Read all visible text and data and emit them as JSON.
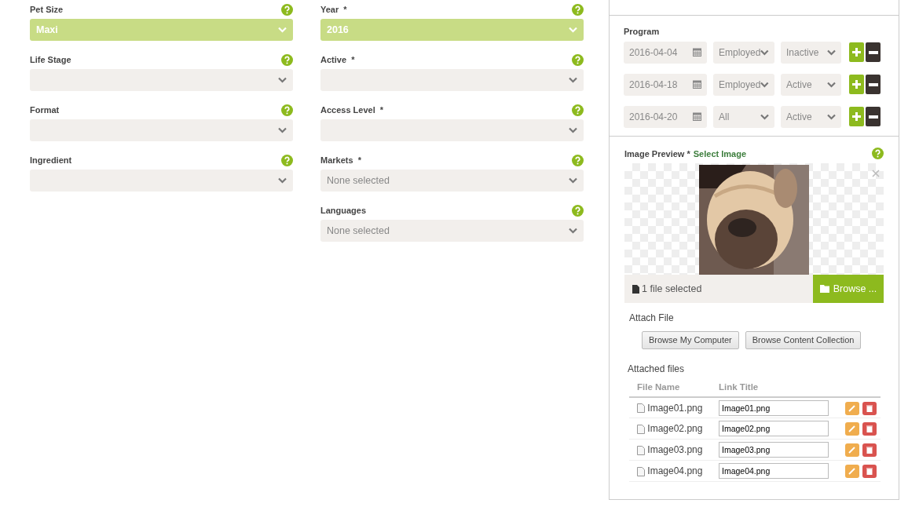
{
  "form": {
    "columns": [
      [
        {
          "label": "Pet Size",
          "highlighted": true,
          "value": "Maxi"
        },
        {
          "label": "Life Stage",
          "highlighted": false
        },
        {
          "label": "Format",
          "highlighted": false
        },
        {
          "label": "Ingredient",
          "highlighted": false
        }
      ],
      [
        {
          "label": "Year  *",
          "highlighted": true,
          "value": "2016"
        },
        {
          "label": "Active  *",
          "highlighted": false
        },
        {
          "label": "Access Level  *",
          "highlighted": false
        },
        {
          "label": "Markets  *",
          "highlighted": false,
          "placeholder": "None selected"
        },
        {
          "label": "Languages",
          "highlighted": false,
          "placeholder": "None selected"
        }
      ]
    ]
  },
  "program": {
    "label": "Program",
    "rows": [
      {
        "date": "2016-04-04",
        "employment": "Employed",
        "status": "Inactive"
      },
      {
        "date": "2016-04-18",
        "employment": "Employed",
        "status": "Active"
      },
      {
        "date": "2016-04-20",
        "employment": "All",
        "status": "Active"
      }
    ]
  },
  "image_preview": {
    "label": "Image Preview *",
    "link": "Select Image",
    "file_info": "1 file selected",
    "browse_button": "Browse ..."
  },
  "attach": {
    "label": "Attach File",
    "buttons": [
      "Browse My Computer",
      "Browse Content Collection"
    ]
  },
  "attached_files": {
    "label": "Attached files",
    "columns": [
      "File Name",
      "Link Title"
    ],
    "rows": [
      {
        "file_name": "Image01.png",
        "link_title": "Image01.png"
      },
      {
        "file_name": "Image02.png",
        "link_title": "Image02.png"
      },
      {
        "file_name": "Image03.png",
        "link_title": "Image03.png"
      },
      {
        "file_name": "Image04.png",
        "link_title": "Image04.png"
      }
    ]
  }
}
